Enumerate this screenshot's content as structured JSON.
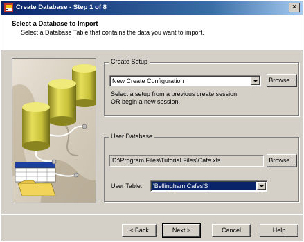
{
  "window": {
    "title": "Create Database - Step 1 of 8",
    "close_label": "×"
  },
  "header": {
    "title": "Select a Database to Import",
    "subtitle": "Select a Database Table that contains the data you want to import."
  },
  "create_setup": {
    "legend": "Create Setup",
    "selected_value": "New Create Configuration",
    "browse_label": "Browse...",
    "hint_line1": "Select  a setup from a previous create session",
    "hint_line2": "OR begin a new session."
  },
  "user_database": {
    "legend": "User Database",
    "path_value": "D:\\Program Files\\Tutorial Files\\Cafe.xls",
    "browse_label": "Browse...",
    "table_label": "User Table:",
    "table_value": "'Bellingham Cafes'$"
  },
  "footer": {
    "back_label": "< Back",
    "next_label": "Next >",
    "cancel_label": "Cancel",
    "help_label": "Help"
  },
  "colors": {
    "titlebar_start": "#0a246a",
    "titlebar_end": "#a6caf0",
    "dialog_bg": "#d4d0c8",
    "selection": "#0a246a",
    "cylinder": "#c8c23a"
  },
  "icons": {
    "app": "database-wizard-icon",
    "close": "close-icon",
    "dropdown": "chevron-down-icon"
  }
}
